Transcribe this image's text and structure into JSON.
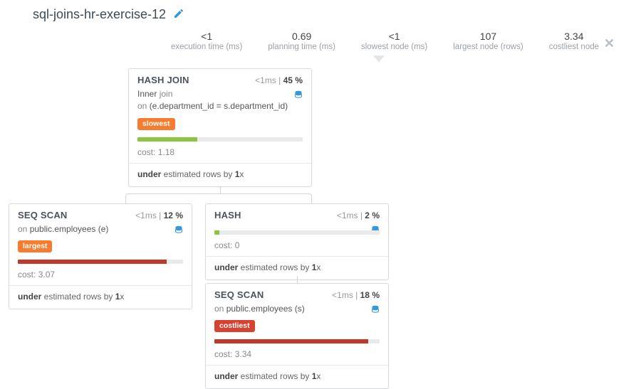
{
  "header": {
    "title": "sql-joins-hr-exercise-12"
  },
  "stats": {
    "exec_val": "<1",
    "exec_label": "execution time (ms)",
    "plan_val": "0.69",
    "plan_label": "planning time (ms)",
    "slow_val": "<1",
    "slow_label": "slowest node (ms)",
    "large_val": "107",
    "large_label": "largest node (rows)",
    "cost_val": "3.34",
    "cost_label": "costliest node"
  },
  "nodes": {
    "hashjoin": {
      "title": "HASH JOIN",
      "time": "<1",
      "unit": "ms",
      "pct": "45",
      "detail_prefix": "Inner ",
      "detail_grey": "join",
      "detail_on": "on ",
      "detail_cond": "(e.department_id = s.department_id)",
      "badge": "slowest",
      "cost_label": "cost: ",
      "cost": "1.18",
      "under_a": "under",
      "under_b": " estimated rows by ",
      "under_c": "1",
      "under_d": "x"
    },
    "seq1": {
      "title": "SEQ SCAN",
      "time": "<1",
      "unit": "ms",
      "pct": "12",
      "detail_on": "on ",
      "detail_cond": "public.employees (e)",
      "badge": "largest",
      "cost_label": "cost: ",
      "cost": "3.07",
      "under_a": "under",
      "under_b": " estimated rows by ",
      "under_c": "1",
      "under_d": "x"
    },
    "hash": {
      "title": "HASH",
      "time": "<1",
      "unit": "ms",
      "pct": "2",
      "cost_label": "cost: ",
      "cost": "0",
      "under_a": "under",
      "under_b": " estimated rows by ",
      "under_c": "1",
      "under_d": "x"
    },
    "seq2": {
      "title": "SEQ SCAN",
      "time": "<1",
      "unit": "ms",
      "pct": "18",
      "detail_on": "on ",
      "detail_cond": "public.employees (s)",
      "badge": "costliest",
      "cost_label": "cost: ",
      "cost": "3.34",
      "under_a": "under",
      "under_b": " estimated rows by ",
      "under_c": "1",
      "under_d": "x"
    }
  }
}
